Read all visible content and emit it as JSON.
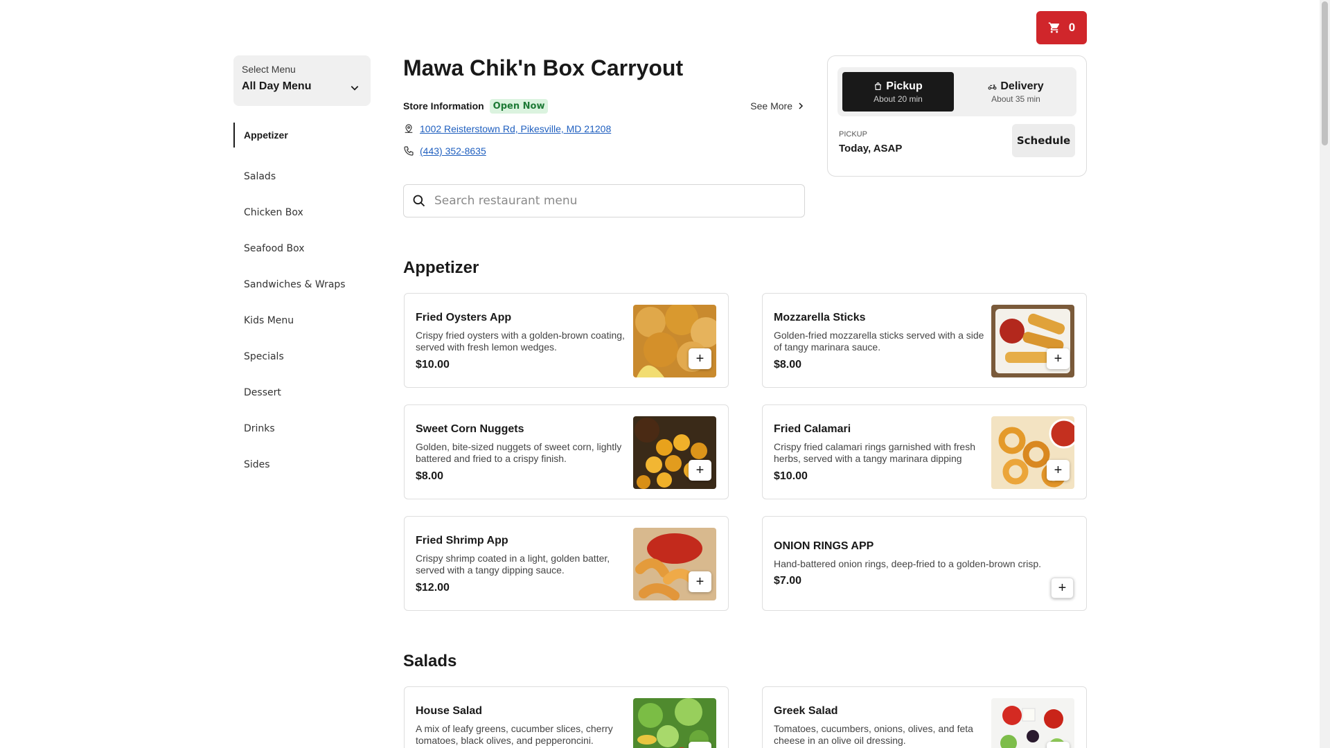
{
  "cart": {
    "count": "0"
  },
  "sidebar": {
    "select_label": "Select Menu",
    "select_value": "All Day Menu",
    "categories": [
      {
        "label": "Appetizer"
      },
      {
        "label": "Salads"
      },
      {
        "label": "Chicken Box"
      },
      {
        "label": "Seafood Box"
      },
      {
        "label": "Sandwiches & Wraps"
      },
      {
        "label": "Kids Menu"
      },
      {
        "label": "Specials"
      },
      {
        "label": "Dessert"
      },
      {
        "label": "Drinks"
      },
      {
        "label": "Sides"
      }
    ]
  },
  "store": {
    "title": "Mawa Chik'n Box Carryout",
    "info_label": "Store Information",
    "status": "Open Now",
    "see_more": "See More",
    "address": "1002 Reisterstown Rd, Pikesville, MD 21208",
    "phone": "(443) 352-8635"
  },
  "search": {
    "placeholder": "Search restaurant menu"
  },
  "order": {
    "pickup_title": "Pickup",
    "pickup_time": "About 20 min",
    "delivery_title": "Delivery",
    "delivery_time": "About 35 min",
    "when_label": "PICKUP",
    "when_value": "Today, ASAP",
    "schedule": "Schedule"
  },
  "sections": [
    {
      "title": "Appetizer",
      "items": [
        {
          "name": "Fried Oysters App",
          "desc": "Crispy fried oysters with a golden-brown coating, served with fresh lemon wedges.",
          "price": "$10.00"
        },
        {
          "name": "Mozzarella Sticks",
          "desc": "Golden-fried mozzarella sticks served with a side of tangy marinara sauce.",
          "price": "$8.00"
        },
        {
          "name": "Sweet Corn Nuggets",
          "desc": "Golden, bite-sized nuggets of sweet corn, lightly battered and fried to a crispy finish.",
          "price": "$8.00"
        },
        {
          "name": "Fried Calamari",
          "desc": "Crispy fried calamari rings garnished with fresh herbs, served with a tangy marinara dipping sauce.",
          "price": "$10.00"
        },
        {
          "name": "Fried Shrimp App",
          "desc": "Crispy shrimp coated in a light, golden batter, served with a tangy dipping sauce.",
          "price": "$12.00"
        },
        {
          "name": "ONION RINGS APP",
          "desc": "Hand-battered onion rings, deep-fried to a golden-brown crisp.",
          "price": "$7.00"
        }
      ]
    },
    {
      "title": "Salads",
      "items": [
        {
          "name": "House Salad",
          "desc": "A mix of leafy greens, cucumber slices, cherry tomatoes, black olives, and pepperoncini.",
          "price": ""
        },
        {
          "name": "Greek Salad",
          "desc": "Tomatoes, cucumbers, onions, olives, and feta cheese in an olive oil dressing.",
          "price": ""
        }
      ]
    }
  ],
  "icons": {
    "cart": "cart-icon",
    "chevron": "chevron-down-icon",
    "location": "location-pin-icon",
    "phone": "phone-icon",
    "search": "search-icon",
    "bag": "shopping-bag-icon",
    "scooter": "scooter-icon",
    "add": "plus-icon"
  },
  "colors": {
    "accent": "#d0262b",
    "link": "#1f5fbf",
    "open_badge_bg": "#dbf3df",
    "open_badge_text": "#1e7a36"
  }
}
